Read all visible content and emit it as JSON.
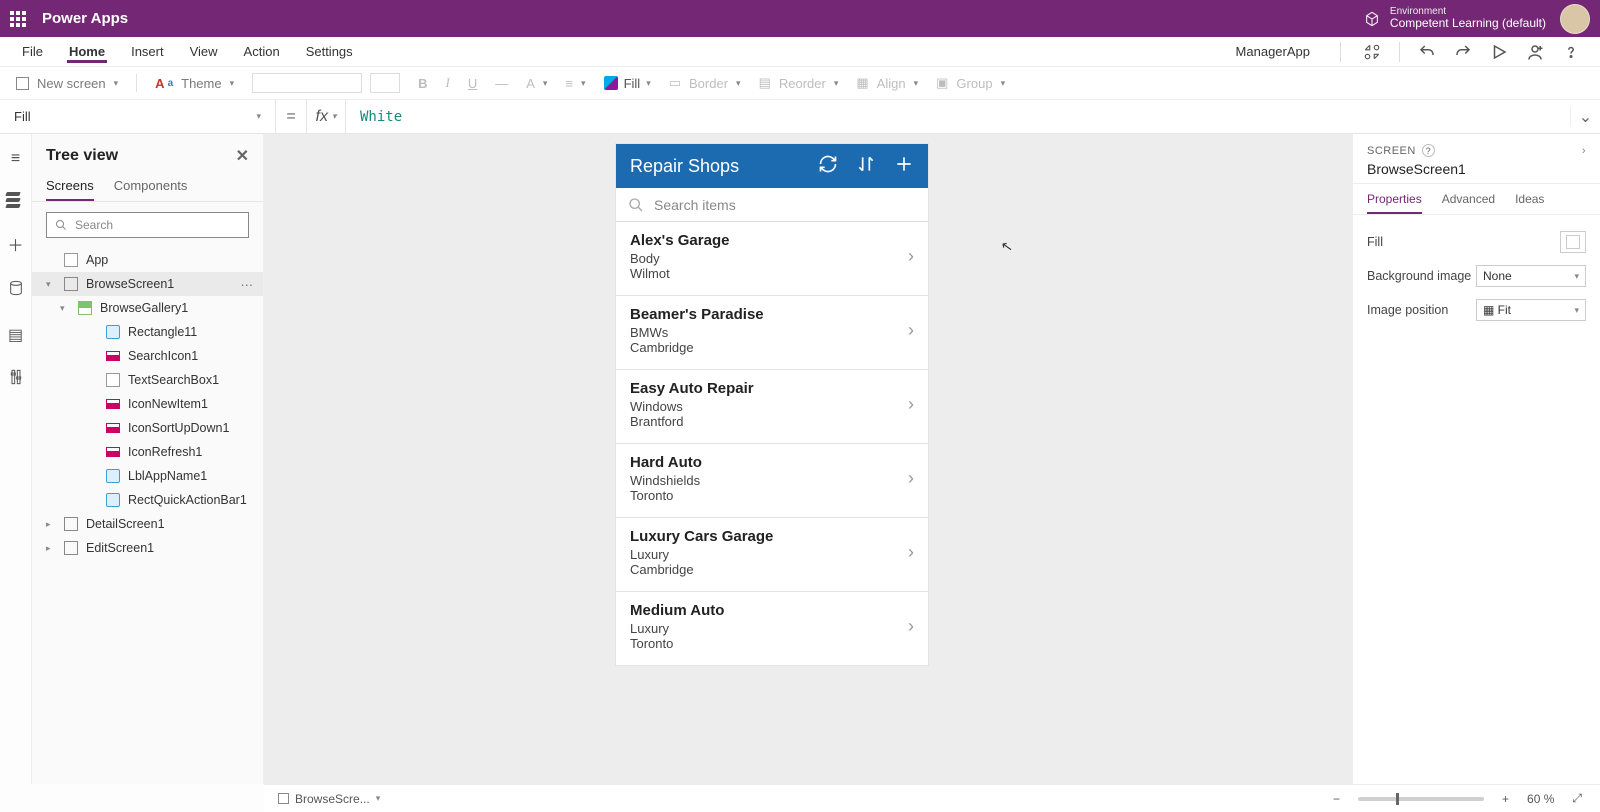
{
  "titlebar": {
    "app": "Power Apps",
    "env_label": "Environment",
    "env_name": "Competent Learning (default)"
  },
  "menubar": {
    "tabs": [
      "File",
      "Home",
      "Insert",
      "View",
      "Action",
      "Settings"
    ],
    "active_index": 1,
    "right_label": "ManagerApp"
  },
  "toolbar": {
    "new_screen": "New screen",
    "theme": "Theme",
    "fill": "Fill",
    "border": "Border",
    "reorder": "Reorder",
    "align": "Align",
    "group": "Group"
  },
  "formula": {
    "property": "Fill",
    "fx": "fx",
    "value": "White"
  },
  "tree": {
    "title": "Tree view",
    "tabs": [
      "Screens",
      "Components"
    ],
    "search_placeholder": "Search",
    "items": [
      {
        "label": "App",
        "icon": "plain",
        "indent": 0
      },
      {
        "label": "BrowseScreen1",
        "icon": "sq",
        "indent": 0,
        "expand": true,
        "selected": true
      },
      {
        "label": "BrowseGallery1",
        "icon": "gal",
        "indent": 1,
        "expand": true
      },
      {
        "label": "Rectangle11",
        "icon": "lbl",
        "indent": 2
      },
      {
        "label": "SearchIcon1",
        "icon": "ctrl",
        "indent": 2
      },
      {
        "label": "TextSearchBox1",
        "icon": "plain",
        "indent": 2
      },
      {
        "label": "IconNewItem1",
        "icon": "ctrl",
        "indent": 2
      },
      {
        "label": "IconSortUpDown1",
        "icon": "ctrl",
        "indent": 2
      },
      {
        "label": "IconRefresh1",
        "icon": "ctrl",
        "indent": 2
      },
      {
        "label": "LblAppName1",
        "icon": "lbl",
        "indent": 2
      },
      {
        "label": "RectQuickActionBar1",
        "icon": "lbl",
        "indent": 2
      },
      {
        "label": "DetailScreen1",
        "icon": "sq",
        "indent": 0,
        "expand": true
      },
      {
        "label": "EditScreen1",
        "icon": "sq",
        "indent": 0,
        "expand": true
      }
    ]
  },
  "phone": {
    "title": "Repair Shops",
    "search_placeholder": "Search items",
    "list": [
      {
        "title": "Alex's Garage",
        "sub1": "Body",
        "sub2": "Wilmot"
      },
      {
        "title": "Beamer's Paradise",
        "sub1": "BMWs",
        "sub2": "Cambridge"
      },
      {
        "title": "Easy Auto Repair",
        "sub1": "Windows",
        "sub2": "Brantford"
      },
      {
        "title": "Hard Auto",
        "sub1": "Windshields",
        "sub2": "Toronto"
      },
      {
        "title": "Luxury Cars Garage",
        "sub1": "Luxury",
        "sub2": "Cambridge"
      },
      {
        "title": "Medium Auto",
        "sub1": "Luxury",
        "sub2": "Toronto"
      }
    ]
  },
  "props": {
    "scope": "SCREEN",
    "selection": "BrowseScreen1",
    "tabs": [
      "Properties",
      "Advanced",
      "Ideas"
    ],
    "rows": {
      "fill_label": "Fill",
      "bg_label": "Background image",
      "bg_value": "None",
      "imgpos_label": "Image position",
      "imgpos_value": "Fit"
    }
  },
  "status": {
    "selection": "BrowseScre...",
    "zoom": "60",
    "zoom_unit": "%"
  }
}
